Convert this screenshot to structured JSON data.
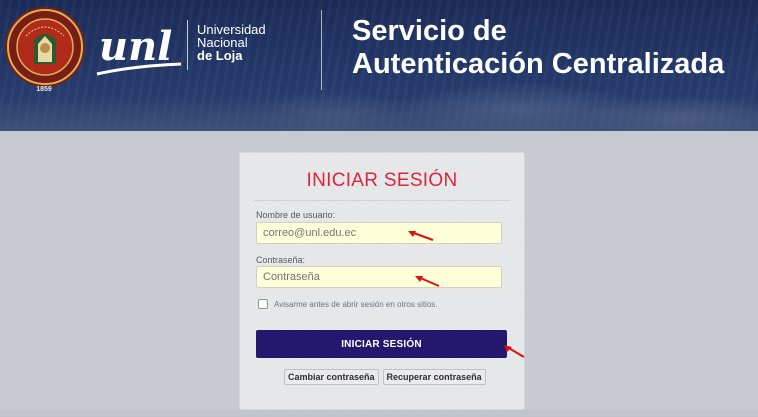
{
  "header": {
    "seal_year": "1859",
    "logo_text": "unl",
    "university_lines": [
      "Universidad",
      "Nacional",
      "de Loja"
    ],
    "service_title_lines": [
      "Servicio de",
      "Autenticación Centralizada"
    ]
  },
  "login": {
    "title": "INICIAR SESIÓN",
    "username_label": "Nombre de usuario:",
    "username_placeholder": "correo@unl.edu.ec",
    "password_label": "Contraseña:",
    "password_placeholder": "Contraseña",
    "warn_checkbox_label": "Avisarme antes de abrir sesión en otros sitios.",
    "warn_checked": false,
    "submit_label": "INICIAR SESIÓN",
    "change_password_label": "Cambiar contraseña",
    "recover_password_label": "Recuperar contraseña"
  },
  "colors": {
    "header_bg": "#1b2b57",
    "title_red": "#d7263d",
    "submit_bg": "#24186e",
    "input_bg": "#fefed8",
    "annotation_arrow": "#e01010"
  }
}
